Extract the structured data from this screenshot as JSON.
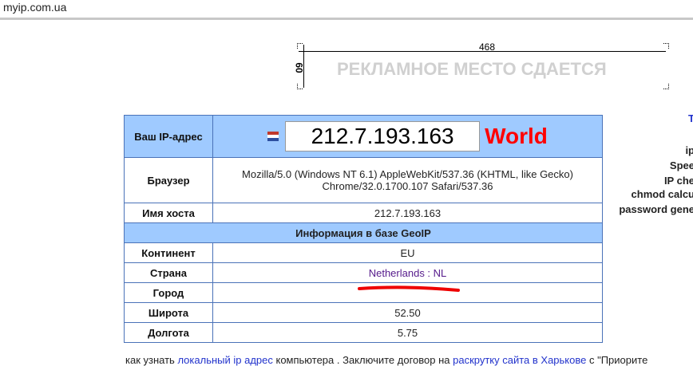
{
  "site": "myip.com.ua",
  "ad": {
    "width_label": "468",
    "height_label": "60",
    "text": "РЕКЛАМНОЕ МЕСТО СДАЕТСЯ"
  },
  "table": {
    "ip_label": "Ваш IP-адрес",
    "ip": "212.7.193.163",
    "region": "World",
    "browser_label": "Браузер",
    "browser_line1": "Mozilla/5.0 (Windows NT 6.1) AppleWebKit/537.36 (KHTML, like Gecko)",
    "browser_line2": "Chrome/32.0.1700.107 Safari/537.36",
    "host_label": "Имя хоста",
    "host": "212.7.193.163",
    "geoip_header": "Информация в базе GeoIP",
    "continent_label": "Континент",
    "continent": "EU",
    "country_label": "Страна",
    "country": "Netherlands : NL",
    "city_label": "Город",
    "city": "",
    "lat_label": "Широта",
    "lat": "52.50",
    "lon_label": "Долгота",
    "lon": "5.75"
  },
  "sidebar": [
    "T",
    "ip",
    "Spee",
    "IP che",
    "chmod calcu",
    "password gene"
  ],
  "footer": {
    "t1": "как узнать ",
    "l1": "локальный ip адрес",
    "t2": " компьютера . Заключите договор на ",
    "l2": "раскрутку сайта в Харькове",
    "t3": " с \"Приорите"
  }
}
